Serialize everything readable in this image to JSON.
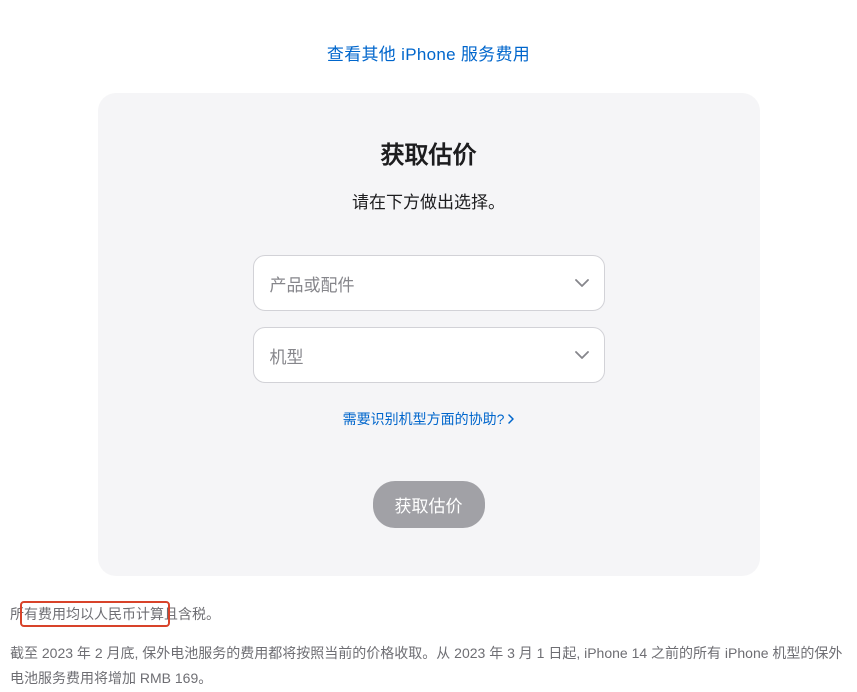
{
  "topLink": {
    "label": "查看其他 iPhone 服务费用"
  },
  "card": {
    "title": "获取估价",
    "subtitle": "请在下方做出选择。",
    "select1": {
      "placeholder": "产品或配件"
    },
    "select2": {
      "placeholder": "机型"
    },
    "helpLink": "需要识别机型方面的协助?",
    "button": "获取估价"
  },
  "footer": {
    "line1": "所有费用均以人民币计算且含税。",
    "line2": "截至 2023 年 2 月底, 保外电池服务的费用都将按照当前的价格收取。从 2023 年 3 月 1 日起, iPhone 14 之前的所有 iPhone 机型的保外电池服务费用将增加 RMB 169。"
  }
}
